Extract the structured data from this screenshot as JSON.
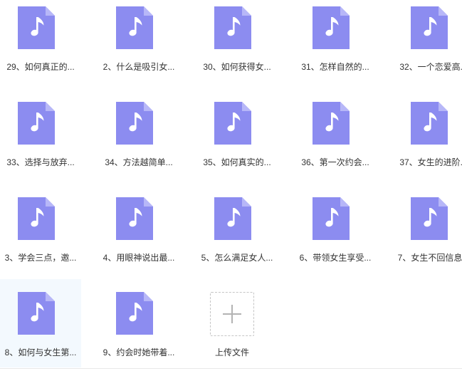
{
  "colors": {
    "icon_body": "#8c8cf0",
    "icon_fold": "#b7b7f8",
    "icon_note": "#ffffff",
    "selected_bg": "#f3f9fe",
    "label_text": "#333333"
  },
  "files": [
    {
      "label": "29、如何真正的...",
      "icon": "music-file-icon"
    },
    {
      "label": "2、什么是吸引女...",
      "icon": "music-file-icon"
    },
    {
      "label": "30、如何获得女...",
      "icon": "music-file-icon"
    },
    {
      "label": "31、怎样自然的...",
      "icon": "music-file-icon"
    },
    {
      "label": "32、一个恋爱高...",
      "icon": "music-file-icon"
    },
    {
      "label": "33、选择与放弃...",
      "icon": "music-file-icon"
    },
    {
      "label": "34、方法越简单...",
      "icon": "music-file-icon"
    },
    {
      "label": "35、如何真实的...",
      "icon": "music-file-icon"
    },
    {
      "label": "36、第一次约会...",
      "icon": "music-file-icon"
    },
    {
      "label": "37、女生的进阶...",
      "icon": "music-file-icon"
    },
    {
      "label": "3、学会三点，邀...",
      "icon": "music-file-icon"
    },
    {
      "label": "4、用眼神说出最...",
      "icon": "music-file-icon"
    },
    {
      "label": "5、怎么满足女人...",
      "icon": "music-file-icon"
    },
    {
      "label": "6、带领女生享受...",
      "icon": "music-file-icon"
    },
    {
      "label": "7、女生不回信息...",
      "icon": "music-file-icon"
    },
    {
      "label": "8、如何与女生第...",
      "icon": "music-file-icon",
      "selected": true
    },
    {
      "label": "9、约会时她带着...",
      "icon": "music-file-icon"
    }
  ],
  "upload": {
    "label": "上传文件",
    "icon": "plus-icon"
  }
}
